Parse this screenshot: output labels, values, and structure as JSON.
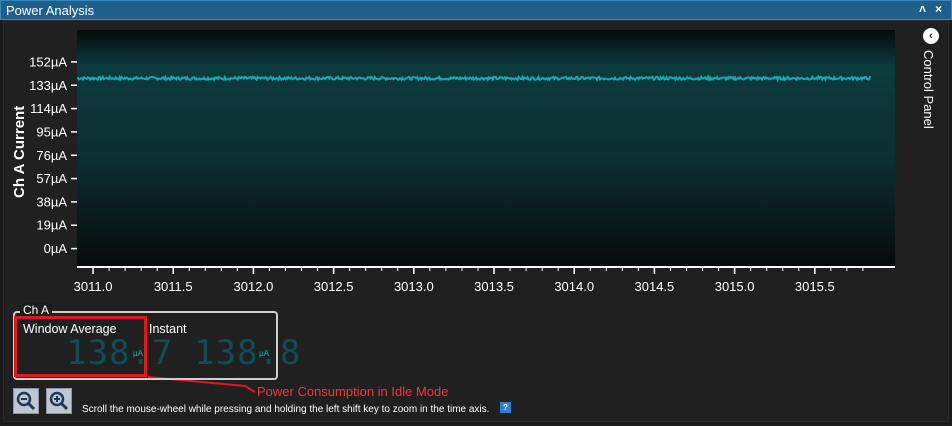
{
  "window": {
    "title": "Power Analysis",
    "minimize_glyph": "˄",
    "close_glyph": "×"
  },
  "side_panel": {
    "label": "Control Panel",
    "collapse_glyph": "‹"
  },
  "chart_data": {
    "type": "line",
    "title": "",
    "ylabel": "Ch A Current",
    "xlabel": "",
    "ylim": [
      -15,
      178
    ],
    "xlim": [
      3010.9,
      3016.0
    ],
    "y_ticks": [
      0,
      19,
      38,
      57,
      76,
      95,
      114,
      133,
      152
    ],
    "y_tick_labels": [
      "0µA",
      "19µA",
      "38µA",
      "57µA",
      "76µA",
      "95µA",
      "114µA",
      "133µA",
      "152µA"
    ],
    "x_ticks": [
      3011.0,
      3011.5,
      3012.0,
      3012.5,
      3013.0,
      3013.5,
      3014.0,
      3014.5,
      3015.0,
      3015.5
    ],
    "x_tick_labels": [
      "3011.0",
      "3011.5",
      "3012.0",
      "3012.5",
      "3013.0",
      "3013.5",
      "3014.0",
      "3014.5",
      "3015.0",
      "3015.5"
    ],
    "series": [
      {
        "x_start": 3010.9,
        "x_end": 3015.85,
        "y_mean": 138.7,
        "y_noise": 1.2,
        "color": "#1aa7b3"
      }
    ],
    "grid": false,
    "legend": "none"
  },
  "channel_group": {
    "label": "Ch A",
    "window_average": {
      "title": "Window Average",
      "value": "138.7",
      "unit": "µA"
    },
    "instant": {
      "title": "Instant",
      "value": "138.8",
      "unit": "µA"
    }
  },
  "annotation": {
    "text": "Power Consumption in Idle Mode",
    "color": "#e1181e"
  },
  "footer": {
    "hint": "Scroll the mouse-wheel while pressing and holding the left shift key to zoom in the time axis.",
    "help_glyph": "?"
  }
}
